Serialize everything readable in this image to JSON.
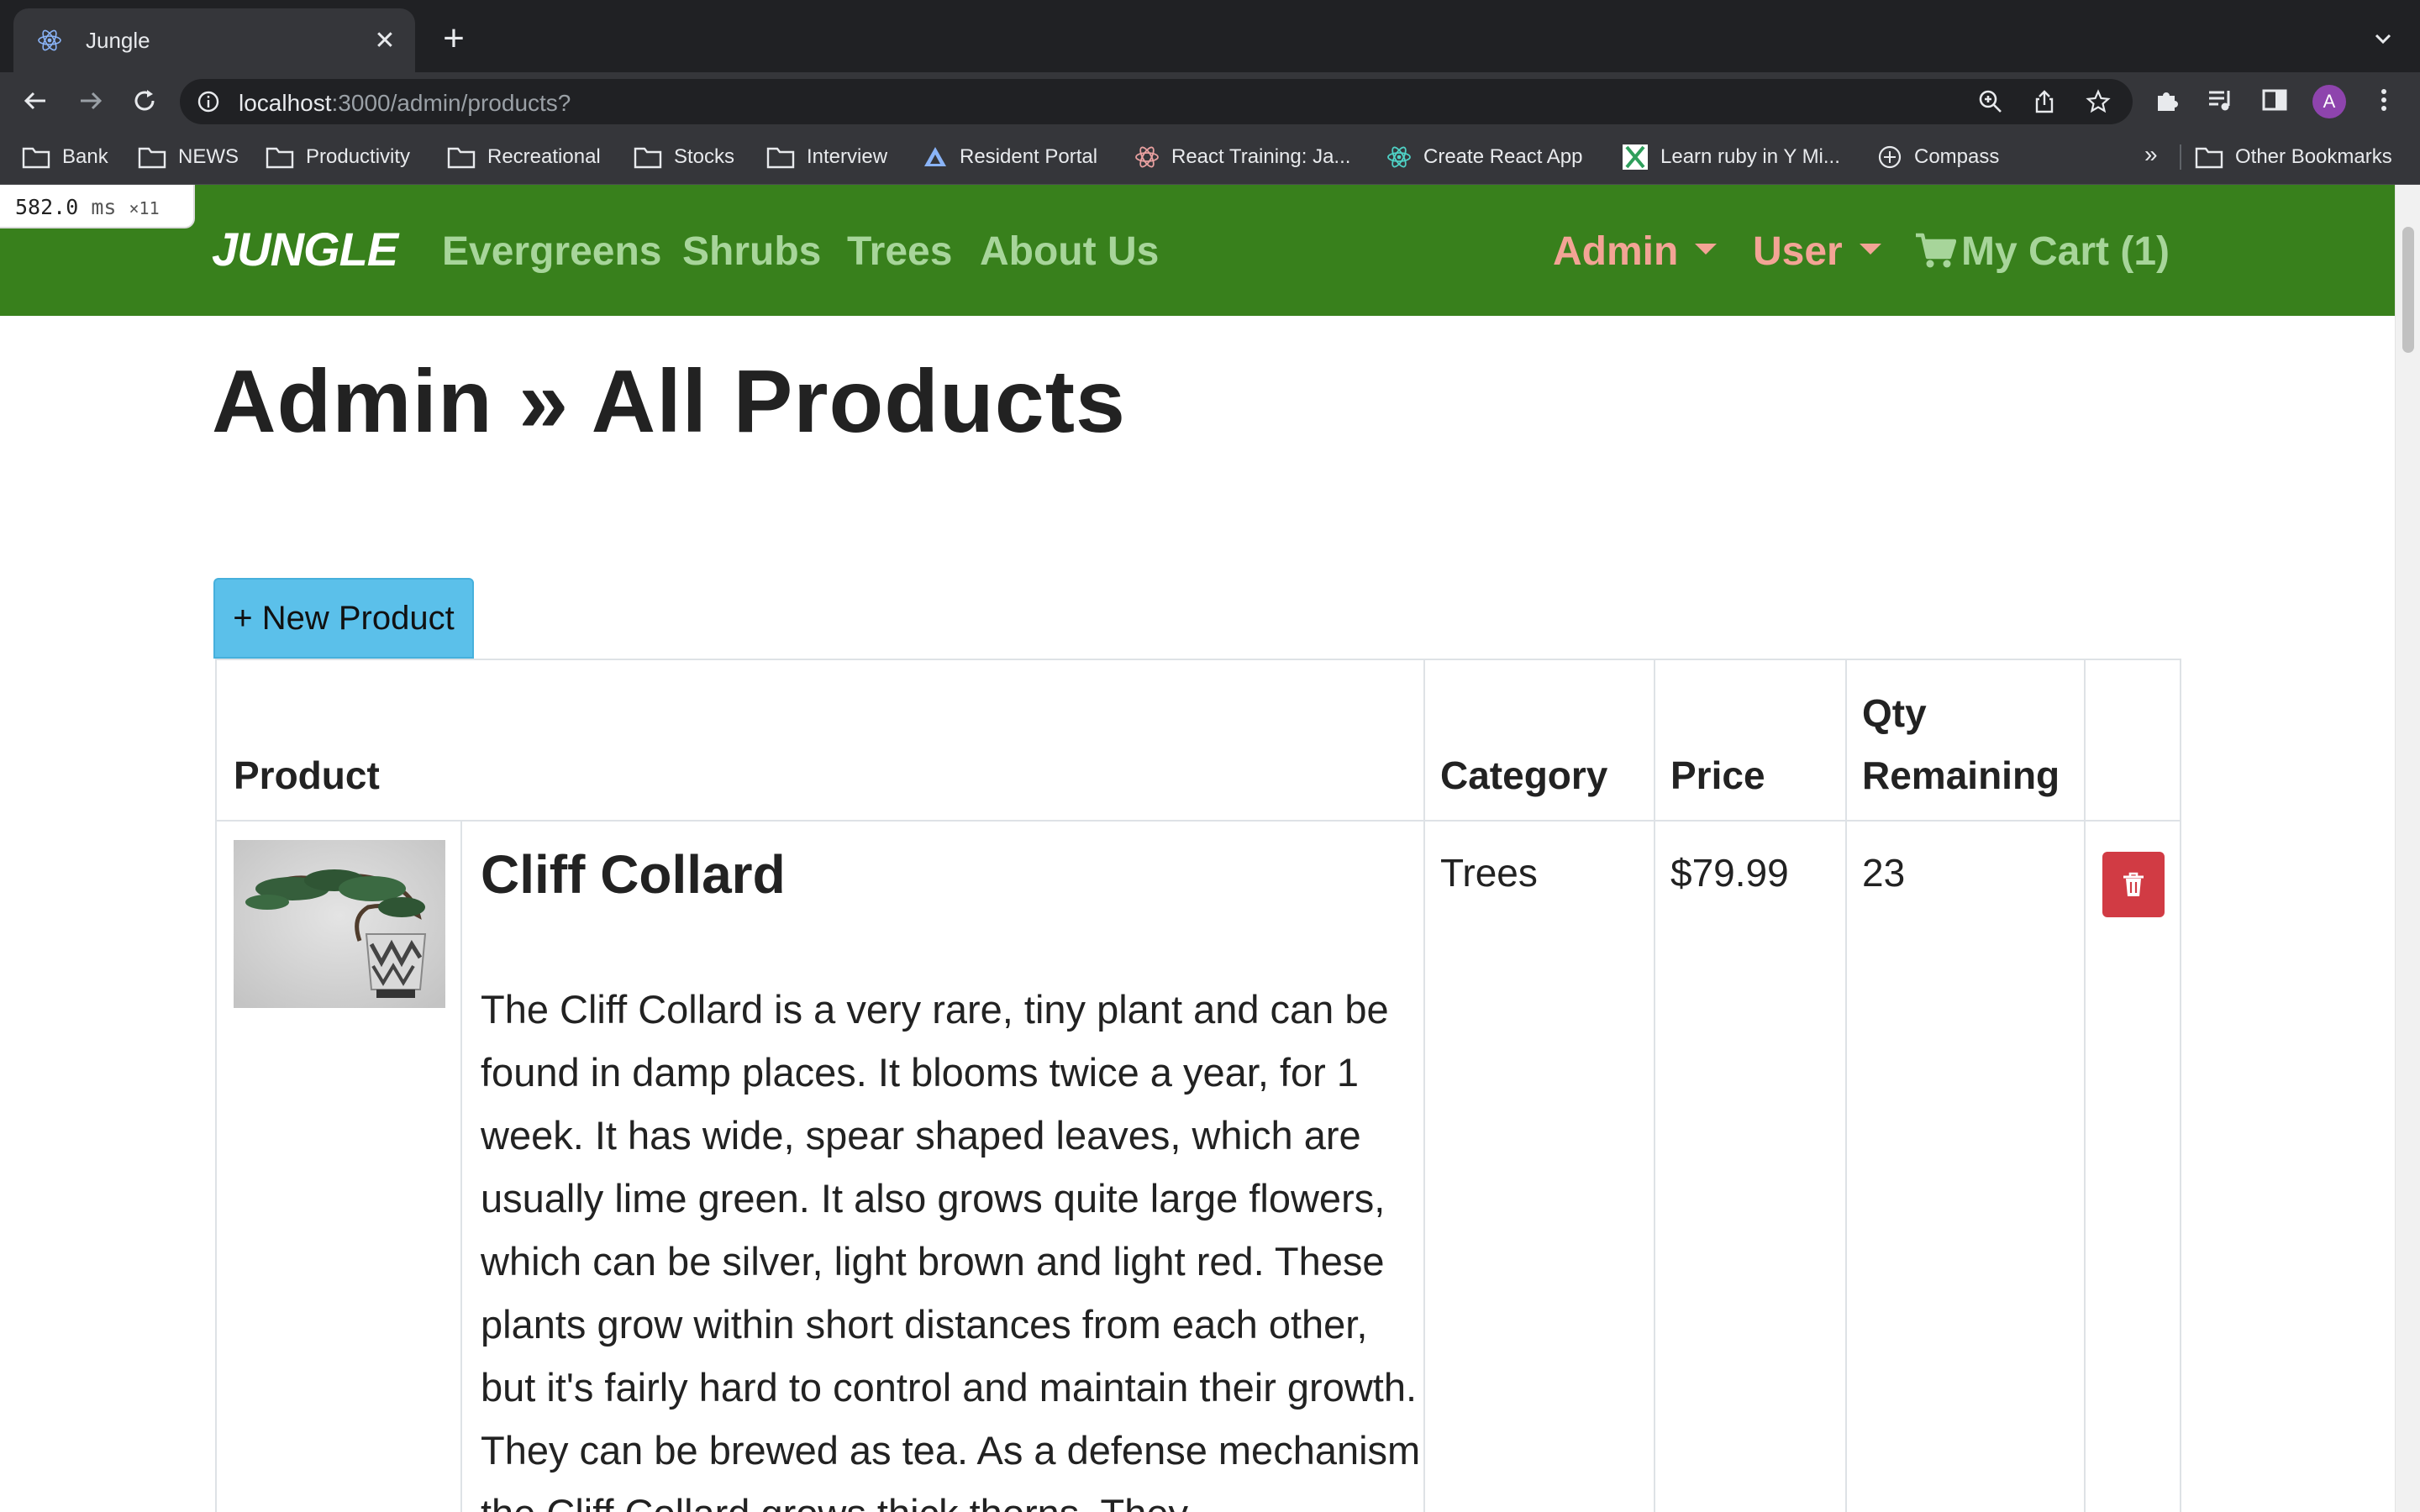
{
  "browser": {
    "tab_title": "Jungle",
    "url_host": "localhost",
    "url_path": ":3000/admin/products?",
    "avatar_letter": "A",
    "bookmarks": [
      {
        "label": "Bank",
        "icon": "folder-icon"
      },
      {
        "label": "NEWS",
        "icon": "folder-icon"
      },
      {
        "label": "Productivity",
        "icon": "folder-icon"
      },
      {
        "label": "Recreational",
        "icon": "folder-icon"
      },
      {
        "label": "Stocks",
        "icon": "folder-icon"
      },
      {
        "label": "Interview",
        "icon": "folder-icon"
      },
      {
        "label": "Resident Portal",
        "icon": "portal-icon"
      },
      {
        "label": "React Training: Ja...",
        "icon": "react-training-icon"
      },
      {
        "label": "Create React App",
        "icon": "react-icon"
      },
      {
        "label": "Learn ruby in Y Mi...",
        "icon": "learnx-icon"
      },
      {
        "label": "Compass",
        "icon": "compass-icon"
      }
    ],
    "more_bookmarks": "»",
    "other_bookmarks": "Other Bookmarks"
  },
  "perf": {
    "value": "582.0",
    "unit": "ms",
    "count": "×11"
  },
  "site_nav": {
    "brand": "JUNGLE",
    "links": [
      "Evergreens",
      "Shrubs",
      "Trees",
      "About Us"
    ],
    "admin": "Admin",
    "user": "User",
    "cart": "My Cart (1)"
  },
  "main": {
    "title": "Admin » All Products",
    "new_product_label": "+ New Product"
  },
  "table": {
    "headers": {
      "product": "Product",
      "category": "Category",
      "price": "Price",
      "qty_line1": "Qty",
      "qty_line2": "Remaining"
    },
    "rows": [
      {
        "name": "Cliff Collard",
        "description": "The Cliff Collard is a very rare, tiny plant and can be found in damp places. It blooms twice a year, for 1 week. It has wide, spear shaped leaves, which are usually lime green. It also grows quite large flowers, which can be silver, light brown and light red. These plants grow within short distances from each other, but it's fairly hard to control and maintain their growth. They can be brewed as tea. As a defense mechanism the Cliff Collard grows thick thorns. They",
        "category": "Trees",
        "price": "$79.99",
        "qty": "23"
      }
    ]
  },
  "colors": {
    "nav_green": "#38801c",
    "nav_link": "#a7d59a",
    "nav_accent": "#f3a495",
    "button_blue": "#5bc0ea",
    "delete_red": "#d13b44"
  }
}
